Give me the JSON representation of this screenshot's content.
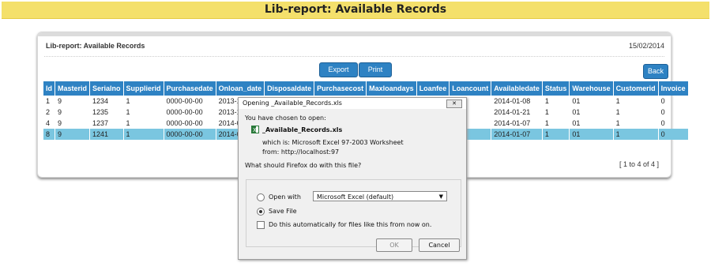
{
  "page": {
    "header_title": "Lib-report: Available Records"
  },
  "panel": {
    "title": "Lib-report: Available Records",
    "date": "15/02/2014",
    "export_label": "Export",
    "print_label": "Print",
    "back_label": "Back",
    "pager": "[ 1 to 4 of 4 ]"
  },
  "table": {
    "columns": [
      "Id",
      "Masterid",
      "Serialno",
      "Supplierid",
      "Purchasedate",
      "Onloan_date",
      "Disposaldate",
      "Purchasecost",
      "Maxloandays",
      "Loanfee",
      "Loancount",
      "Availabledate",
      "Status",
      "Warehouse",
      "Customerid",
      "Invoice"
    ],
    "rows": [
      [
        "1",
        "9",
        "1234",
        "1",
        "0000-00-00",
        "2013-12",
        "",
        "",
        "",
        "",
        "",
        "2014-01-08",
        "1",
        "01",
        "1",
        "0"
      ],
      [
        "2",
        "9",
        "1235",
        "1",
        "0000-00-00",
        "2013-12-",
        "",
        "",
        "",
        "",
        "",
        "2014-01-21",
        "1",
        "01",
        "1",
        "0"
      ],
      [
        "4",
        "9",
        "1237",
        "1",
        "0000-00-00",
        "2014-01-",
        "",
        "",
        "",
        "",
        "",
        "2014-01-07",
        "1",
        "01",
        "1",
        "0"
      ],
      [
        "8",
        "9",
        "1241",
        "1",
        "0000-00-00",
        "2014-01-",
        "",
        "",
        "",
        "",
        "",
        "2014-01-07",
        "1",
        "01",
        "1",
        "0"
      ]
    ],
    "selected_row": 3
  },
  "dialog": {
    "title": "Opening _Available_Records.xls",
    "close_glyph": "✕",
    "chosen_label": "You have chosen to open:",
    "file_name": "_Available_Records.xls",
    "which_is": "which is:  Microsoft Excel 97-2003 Worksheet",
    "from": "from:  http://localhost:97",
    "question": "What should Firefox do with this file?",
    "open_with_label": "Open with",
    "open_with_app": "Microsoft Excel (default)",
    "save_file_label": "Save File",
    "auto_label": "Do this automatically for files like this from now on.",
    "ok_label": "OK",
    "cancel_label": "Cancel",
    "selected_option": "save"
  }
}
